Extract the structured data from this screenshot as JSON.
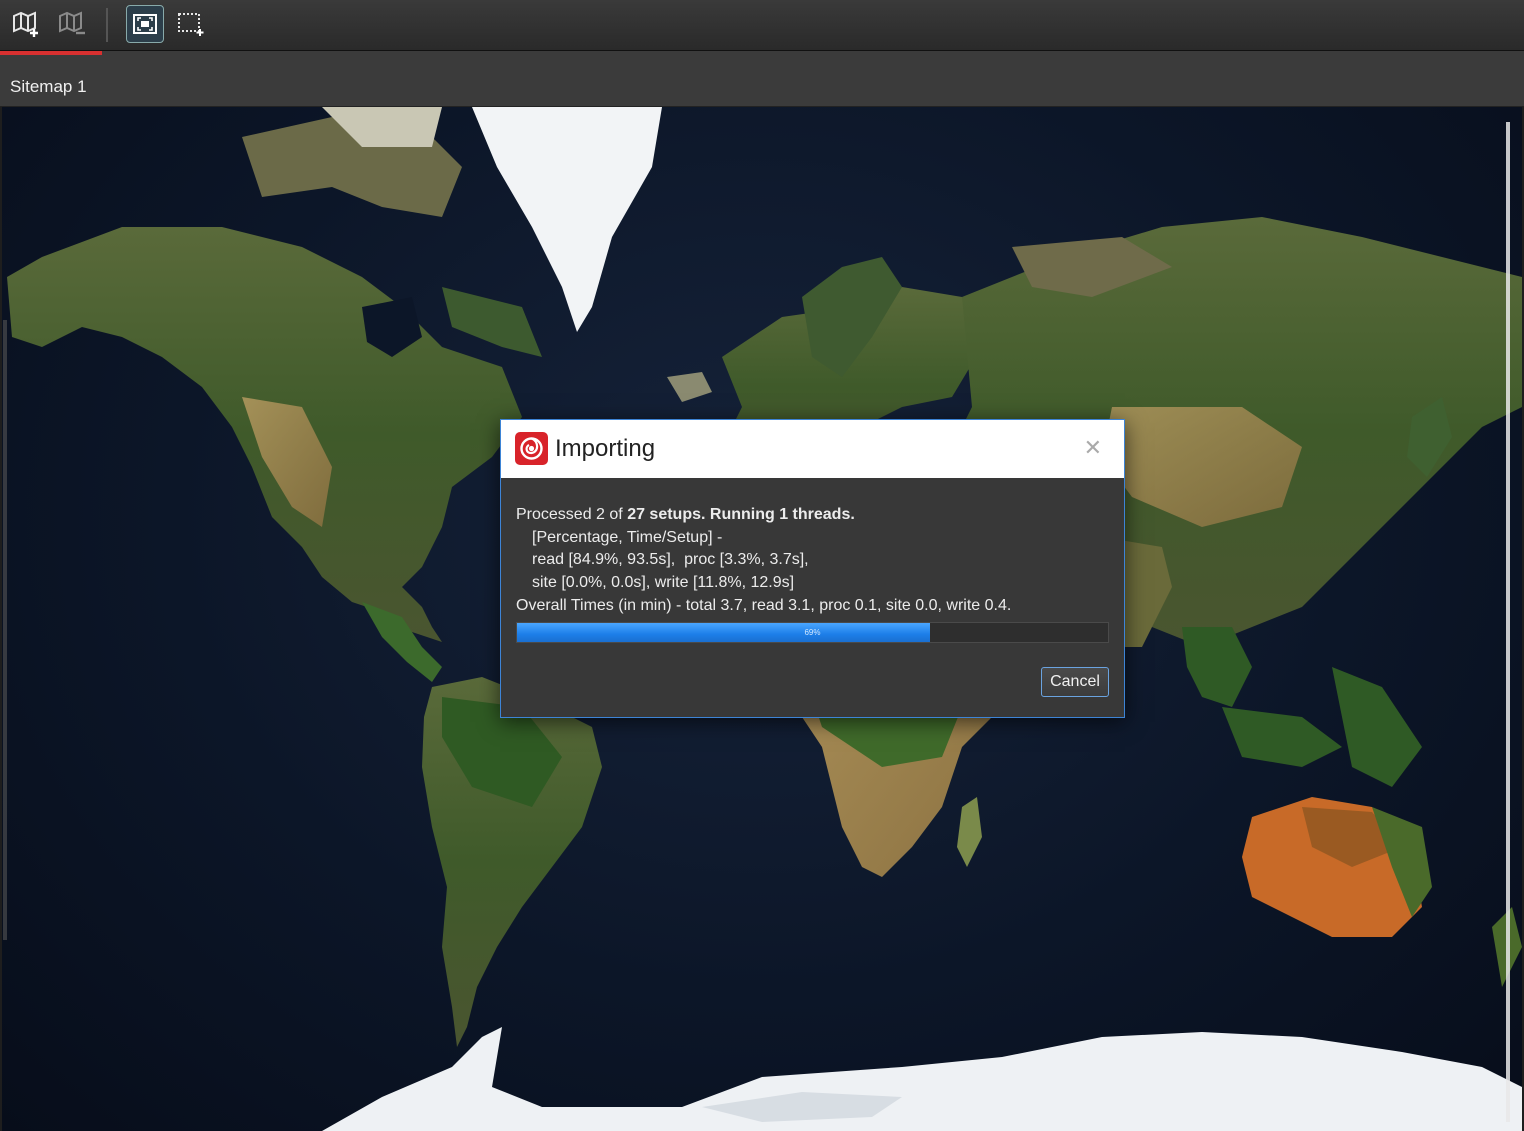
{
  "toolbar": {
    "buttons": [
      {
        "icon": "add-map-icon",
        "active": false
      },
      {
        "icon": "remove-map-icon",
        "active": false
      },
      {
        "icon": "fit-to-window-icon",
        "active": true
      },
      {
        "icon": "select-region-icon",
        "active": false
      }
    ]
  },
  "tabs": [
    {
      "label": "Sitemap 1",
      "active": true,
      "accent": "#d83030"
    }
  ],
  "map": {
    "content": "satellite-world-map"
  },
  "dialog": {
    "title": "Importing",
    "logo_icon": "app-logo-icon",
    "close_icon": "close-icon",
    "close_glyph": "✕",
    "status": {
      "prefix": "Processed ",
      "done": "2",
      "of": " of ",
      "total": "27",
      "rest": " setups. Running 1 threads."
    },
    "lines": [
      "[Percentage, Time/Setup] -",
      "read [84.9%, 93.5s],  proc [3.3%, 3.7s],",
      "site [0.0%, 0.0s], write [11.8%, 12.9s]"
    ],
    "overall": "Overall Times (in min) - total 3.7, read 3.1, proc 0.1, site 0.0, write 0.4.",
    "progress": {
      "fraction": 0.698,
      "label": "69%"
    },
    "cancel_label": "Cancel",
    "accent": "#3d84d6"
  }
}
